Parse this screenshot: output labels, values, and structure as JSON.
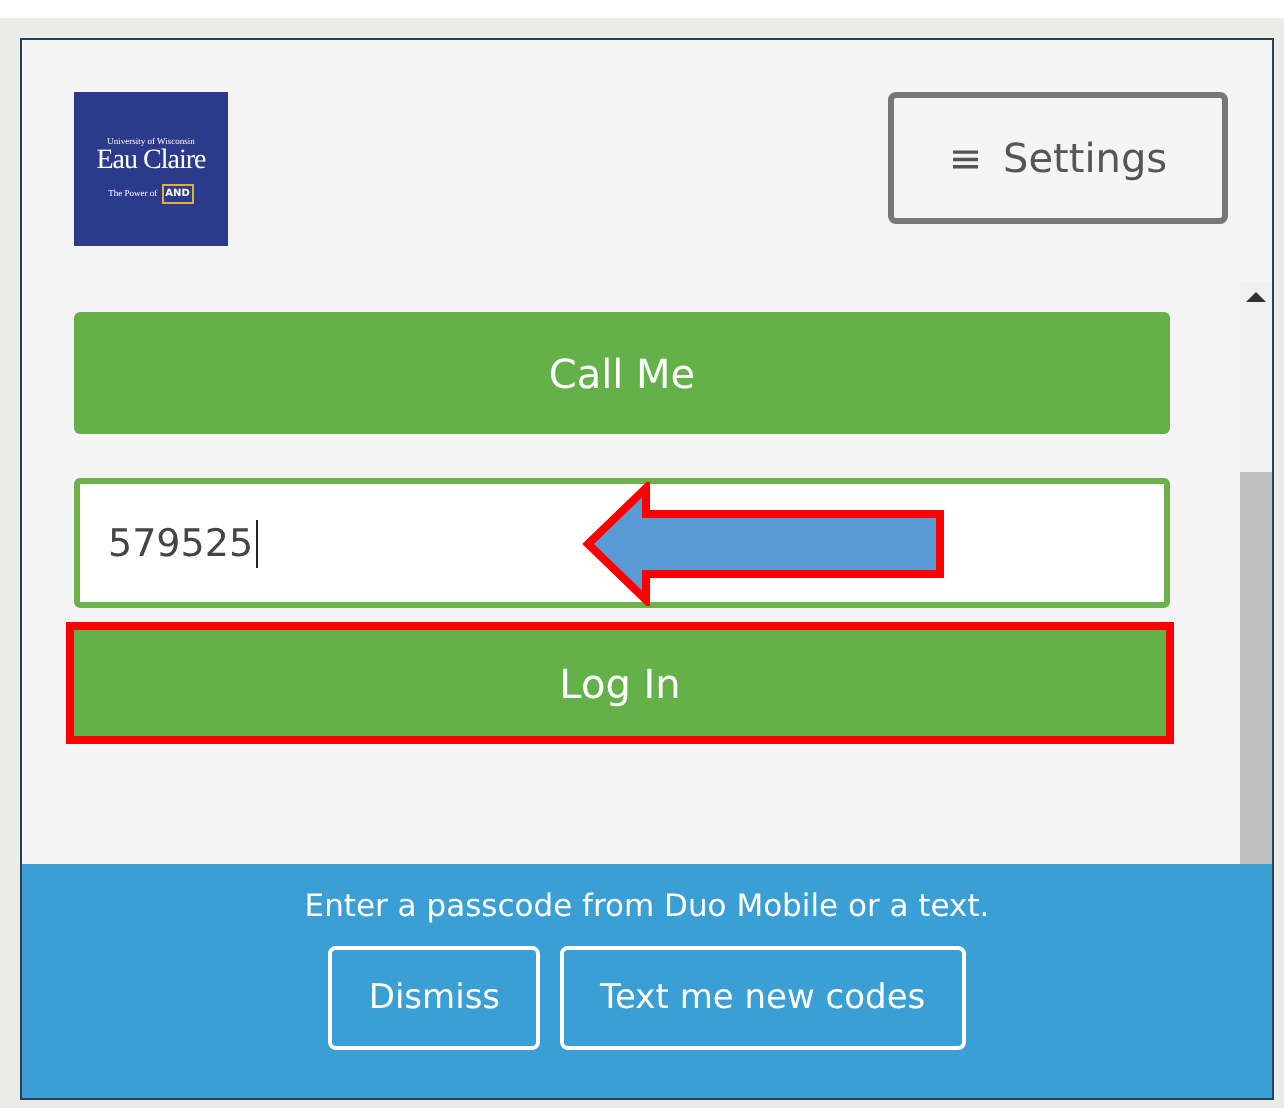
{
  "logo": {
    "line_1": "University of Wisconsin",
    "line_2": "Eau Claire",
    "line_3": "The Power of",
    "badge": "AND"
  },
  "settings_button": {
    "icon": "≡",
    "label": "Settings"
  },
  "call_button": {
    "label": "Call Me"
  },
  "passcode_field": {
    "value": "579525",
    "focused": true
  },
  "login_button": {
    "label": "Log In",
    "highlighted": true
  },
  "annotation": {
    "kind": "arrow"
  },
  "message_bar": {
    "text": "Enter a passcode from Duo Mobile or a text.",
    "buttons": [
      "Dismiss",
      "Text me new codes"
    ]
  }
}
